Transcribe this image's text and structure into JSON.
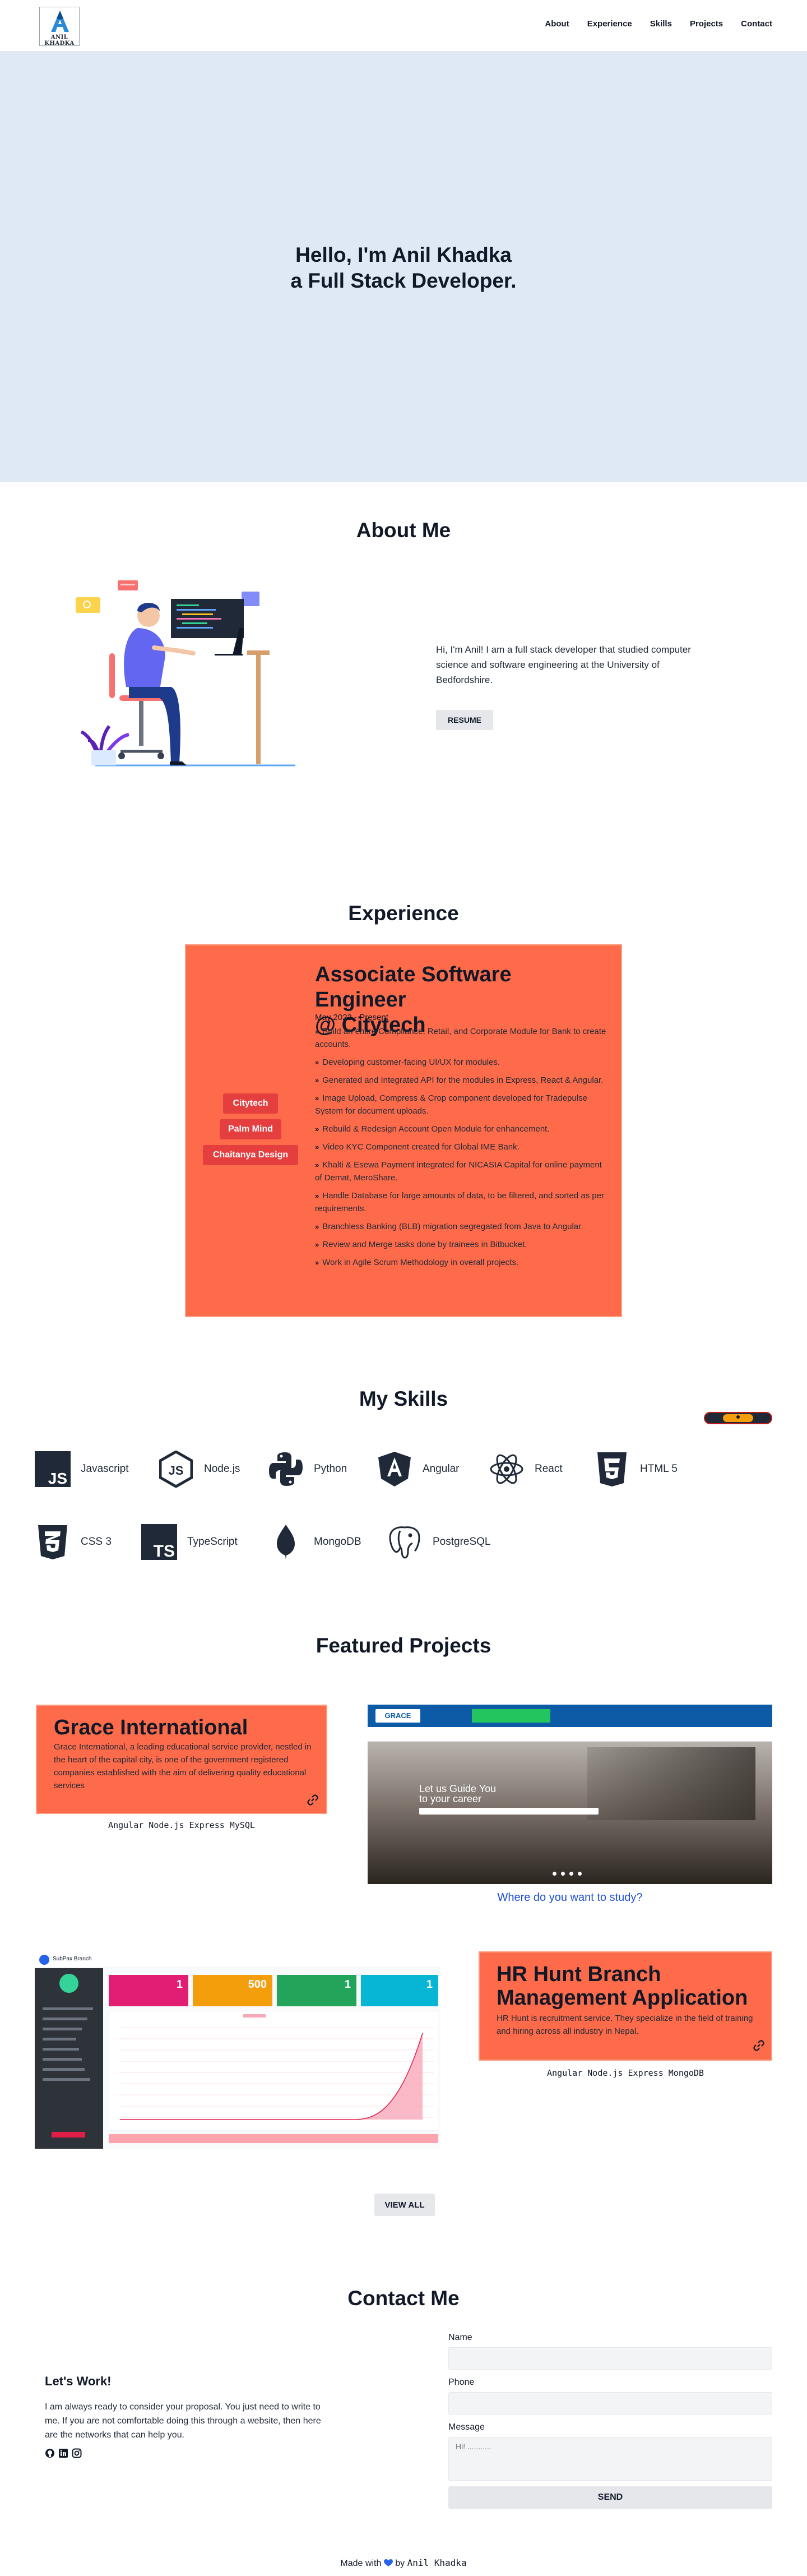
{
  "brand": {
    "logo_text": "ANIL KHADKA",
    "accent": "#fe6b4a",
    "hero_bg": "#dfe8f5"
  },
  "nav": {
    "links": [
      "About",
      "Experience",
      "Skills",
      "Projects",
      "Contact"
    ]
  },
  "hero": {
    "line1": "Hello, I'm Anil Khadka",
    "line2": "a Full Stack Developer."
  },
  "about": {
    "title": "About Me",
    "text": "Hi, I'm Anil! I am a full stack developer that studied computer science and software engineering at the University of Bedfordshire.",
    "resume_label": "RESUME"
  },
  "experience": {
    "title": "Experience",
    "tabs": [
      "Citytech",
      "Palm Mind",
      "Chaitanya Design"
    ],
    "role_line1": "Associate Software Engineer",
    "role_line2": "@ Citytech",
    "date": "May 2022 - Present",
    "bullets": [
      "Build an entire Compliance, Retail, and Corporate Module for Bank to create accounts.",
      "Developing customer-facing UI/UX for modules.",
      "Generated and Integrated API for the modules in Express, React & Angular.",
      "Image Upload, Compress & Crop component developed for Tradepulse System for document uploads.",
      "Rebuild & Redesign Account Open Module for enhancement.",
      "Video KYC Component created for Global IME Bank.",
      "Khalti & Esewa Payment integrated for NICASIA Capital for online payment of Demat, MeroShare.",
      "Handle Database for large amounts of data, to be filtered, and sorted as per requirements.",
      "Branchless Banking (BLB) migration segregated from Java to Angular.",
      "Review and Merge tasks done by trainees in Bitbucket.",
      "Work in Agile Scrum Methodology in overall projects."
    ]
  },
  "skills": {
    "title": "My Skills",
    "items": [
      {
        "name": "Javascript",
        "icon": "js-icon"
      },
      {
        "name": "Node.js",
        "icon": "nodejs-icon"
      },
      {
        "name": "Python",
        "icon": "python-icon"
      },
      {
        "name": "Angular",
        "icon": "angular-icon"
      },
      {
        "name": "React",
        "icon": "react-icon"
      },
      {
        "name": "HTML 5",
        "icon": "html5-icon"
      },
      {
        "name": "CSS 3",
        "icon": "css3-icon"
      },
      {
        "name": "TypeScript",
        "icon": "typescript-icon"
      },
      {
        "name": "MongoDB",
        "icon": "mongodb-icon"
      },
      {
        "name": "PostgreSQL",
        "icon": "postgresql-icon"
      }
    ]
  },
  "projects": {
    "title": "Featured Projects",
    "items": [
      {
        "title": "Grace International",
        "description": "Grace International, a leading educational service provider, nestled in the heart of the capital city, is one of the government registered companies established with the aim of delivering quality educational services",
        "tech": "Angular Node.js Express MySQL",
        "screenshot": {
          "brand": "GRACE",
          "headline_line1": "Let us Guide You",
          "headline_line2": "to your career",
          "caption": "Where do you want to study?"
        }
      },
      {
        "title_line1": "HR Hunt Branch",
        "title_line2": "Management Application",
        "description": "HR Hunt is recruitment service. They specialize in the field of training and hiring across all industry in Nepal.",
        "tech": "Angular Node.js Express MongoDB",
        "screenshot": {
          "brand": "SubPax Branch",
          "stats": [
            "1",
            "500",
            "1",
            "1"
          ]
        }
      }
    ],
    "view_all_label": "VIEW ALL"
  },
  "contact": {
    "title": "Contact Me",
    "heading": "Let's Work!",
    "text": "I am always ready to consider your proposal. You just need to write to me. If you are not comfortable doing this through a website, then here are the networks that can help you.",
    "fields": {
      "name_label": "Name",
      "phone_label": "Phone",
      "message_label": "Message",
      "message_placeholder": "Hi! ..........."
    },
    "send_label": "SEND"
  },
  "footer": {
    "prefix": "Made with",
    "by": "by",
    "author": "Anil Khadka"
  }
}
